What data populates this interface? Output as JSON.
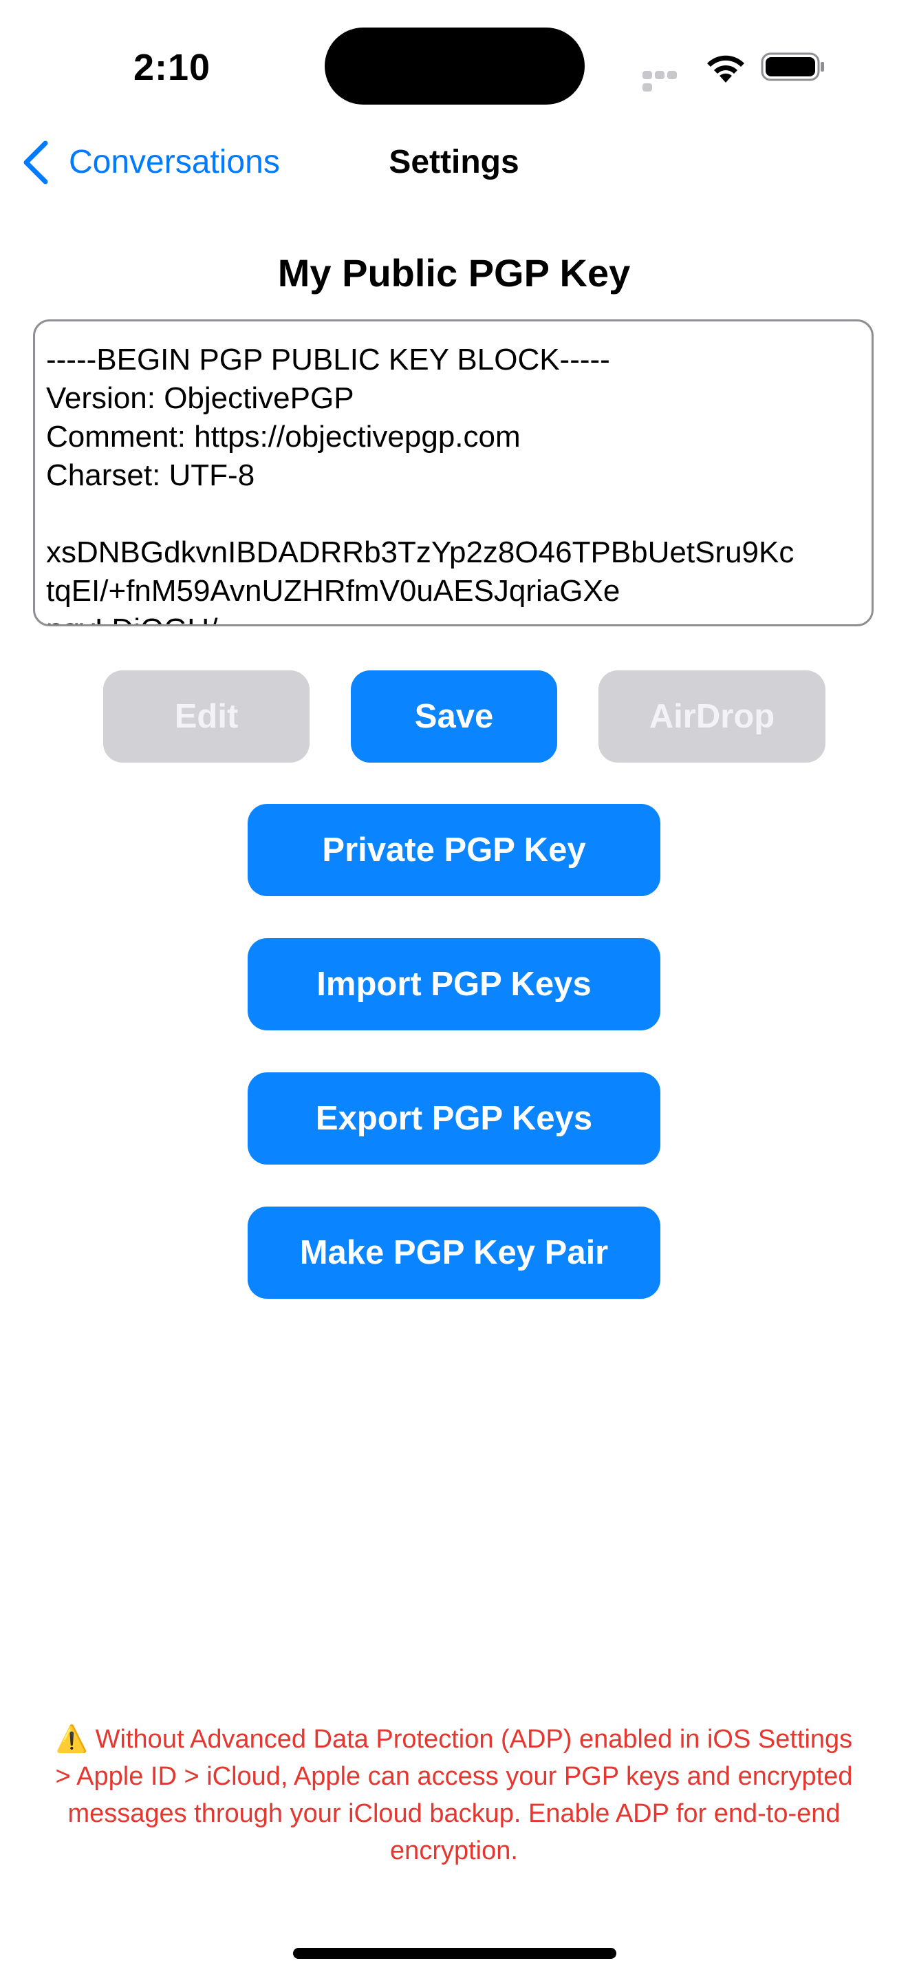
{
  "status_bar": {
    "time": "2:10"
  },
  "nav": {
    "back_label": "Conversations",
    "title": "Settings"
  },
  "section_title": "My Public PGP Key",
  "public_key_text": "-----BEGIN PGP PUBLIC KEY BLOCK-----\nVersion: ObjectivePGP\nComment: https://objectivepgp.com\nCharset: UTF-8\n\nxsDNBGdkvnIBDADRRb3TzYp2z8O46TPBbUetSru9Kc\ntqEI/+fnM59AvnUZHRfmV0uAESJqriaGXe\nnqyLDiOGU/",
  "buttons": {
    "edit": "Edit",
    "save": "Save",
    "airdrop": "AirDrop",
    "private_key": "Private PGP Key",
    "import_keys": "Import PGP Keys",
    "export_keys": "Export PGP Keys",
    "make_key_pair": "Make PGP Key Pair"
  },
  "warning": {
    "icon": "warning-icon",
    "text": "⚠️ Without Advanced Data Protection (ADP) enabled in iOS Settings > Apple ID > iCloud, Apple can access your PGP keys and encrypted messages through your iCloud backup. Enable ADP for end-to-end encryption."
  },
  "colors": {
    "accent": "#0a84ff",
    "disabled": "#d1d1d6",
    "warning": "#e5362f"
  }
}
